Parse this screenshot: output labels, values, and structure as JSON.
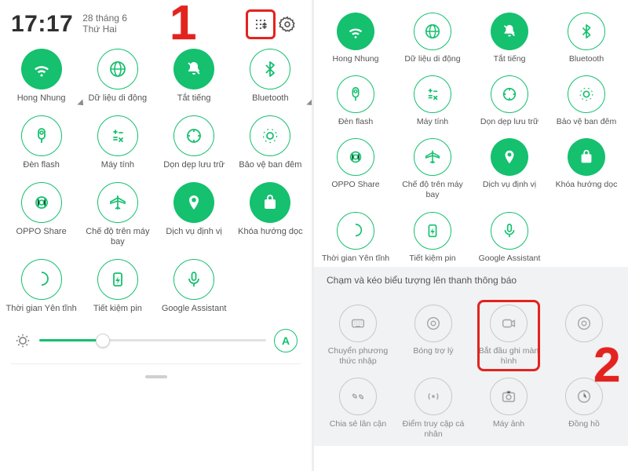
{
  "step1": "1",
  "step2": "2",
  "left": {
    "time": "17:17",
    "date_line1": "28 tháng 6",
    "date_line2": "Thứ Hai",
    "auto_brightness": "A",
    "tiles": [
      {
        "name": "wifi",
        "label": "Hong Nhung",
        "state": "on",
        "expand": true
      },
      {
        "name": "mobile-data",
        "label": "Dữ liệu di động",
        "state": "off"
      },
      {
        "name": "mute",
        "label": "Tắt tiếng",
        "state": "on"
      },
      {
        "name": "bluetooth",
        "label": "Bluetooth",
        "state": "off",
        "expand": true
      },
      {
        "name": "flashlight",
        "label": "Đèn flash",
        "state": "off"
      },
      {
        "name": "calculator",
        "label": "Máy tính",
        "state": "off"
      },
      {
        "name": "cleanup",
        "label": "Dọn dẹp lưu trữ",
        "state": "off"
      },
      {
        "name": "night",
        "label": "Bảo vệ ban đêm",
        "state": "off"
      },
      {
        "name": "oppo-share",
        "label": "OPPO Share",
        "state": "off"
      },
      {
        "name": "airplane",
        "label": "Chế độ trên máy bay",
        "state": "off"
      },
      {
        "name": "location",
        "label": "Dịch vụ định vị",
        "state": "on"
      },
      {
        "name": "rotation-lock",
        "label": "Khóa hướng dọc",
        "state": "on"
      },
      {
        "name": "dnd",
        "label": "Thời gian Yên tĩnh",
        "state": "off"
      },
      {
        "name": "battery-saver",
        "label": "Tiết kiệm pin",
        "state": "off"
      },
      {
        "name": "assistant",
        "label": "Google Assistant",
        "state": "off"
      }
    ]
  },
  "right": {
    "tiles": [
      {
        "name": "wifi",
        "label": "Hong Nhung",
        "state": "on"
      },
      {
        "name": "mobile-data",
        "label": "Dữ liệu di động",
        "state": "off"
      },
      {
        "name": "mute",
        "label": "Tắt tiếng",
        "state": "on"
      },
      {
        "name": "bluetooth",
        "label": "Bluetooth",
        "state": "off"
      },
      {
        "name": "flashlight",
        "label": "Đèn flash",
        "state": "off"
      },
      {
        "name": "calculator",
        "label": "Máy tính",
        "state": "off"
      },
      {
        "name": "cleanup",
        "label": "Dọn dẹp lưu trữ",
        "state": "off"
      },
      {
        "name": "night",
        "label": "Bảo vệ ban đêm",
        "state": "off"
      },
      {
        "name": "oppo-share",
        "label": "OPPO Share",
        "state": "off"
      },
      {
        "name": "airplane",
        "label": "Chế độ trên máy bay",
        "state": "off"
      },
      {
        "name": "location",
        "label": "Dịch vụ định vị",
        "state": "on"
      },
      {
        "name": "rotation-lock",
        "label": "Khóa hướng dọc",
        "state": "on"
      },
      {
        "name": "dnd",
        "label": "Thời gian Yên tĩnh",
        "state": "off"
      },
      {
        "name": "battery-saver",
        "label": "Tiết kiệm pin",
        "state": "off"
      },
      {
        "name": "assistant",
        "label": "Google Assistant",
        "state": "off"
      }
    ],
    "edit_title": "Chạm và kéo biểu tượng lên thanh thông báo",
    "edit_tiles": [
      {
        "name": "input-method",
        "label": "Chuyển phương thức nhập"
      },
      {
        "name": "assistive-ball",
        "label": "Bóng trợ lý"
      },
      {
        "name": "screen-record",
        "label": "Bắt đầu ghi màn hình"
      },
      {
        "name": "tile-extra",
        "label": ""
      },
      {
        "name": "nearby-share",
        "label": "Chia sẻ lân cận"
      },
      {
        "name": "hotspot",
        "label": "Điểm truy cập cá nhân"
      },
      {
        "name": "camera",
        "label": "Máy ảnh"
      },
      {
        "name": "clock",
        "label": "Đồng hồ"
      }
    ]
  },
  "colors": {
    "accent": "#15c06f",
    "highlight": "#e3231f"
  }
}
